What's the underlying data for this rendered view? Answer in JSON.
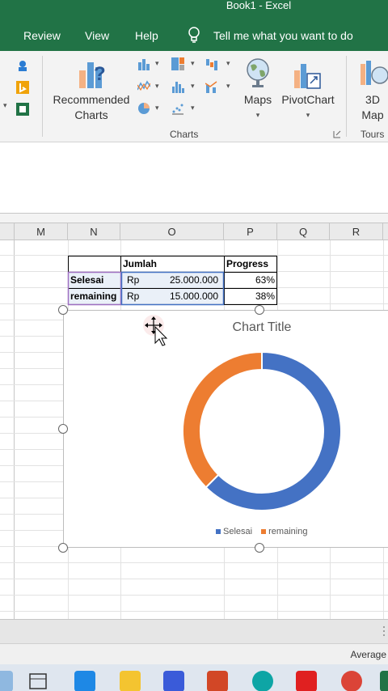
{
  "window": {
    "title": "Book1  -  Excel"
  },
  "tabs": [
    {
      "label": "Review"
    },
    {
      "label": "View"
    },
    {
      "label": "Help"
    }
  ],
  "tellme": {
    "label": "Tell me what you want to do"
  },
  "ribbon": {
    "recommended_charts": {
      "line1": "Recommended",
      "line2": "Charts"
    },
    "maps": {
      "label": "Maps"
    },
    "pivotchart": {
      "label": "PivotChart"
    },
    "map3d": {
      "line1": "3D",
      "line2": "Map"
    },
    "charts_group": "Charts",
    "tours_group": "Tours"
  },
  "columns": [
    "M",
    "N",
    "O",
    "P",
    "Q",
    "R"
  ],
  "table": {
    "header": {
      "jumlah": "Jumlah",
      "progress": "Progress"
    },
    "rows": [
      {
        "label": "Selesai",
        "currency": "Rp",
        "amount": "25.000.000",
        "progress": "63%"
      },
      {
        "label": "remaining",
        "currency": "Rp",
        "amount": "15.000.000",
        "progress": "38%"
      }
    ]
  },
  "chart_data": {
    "type": "pie",
    "variant": "doughnut",
    "title": "Chart Title",
    "categories": [
      "Selesai",
      "remaining"
    ],
    "values": [
      25000000,
      15000000
    ],
    "colors": [
      "#4472c4",
      "#ed7d31"
    ],
    "legend": "bottom"
  },
  "status": {
    "average_label": "Average"
  }
}
